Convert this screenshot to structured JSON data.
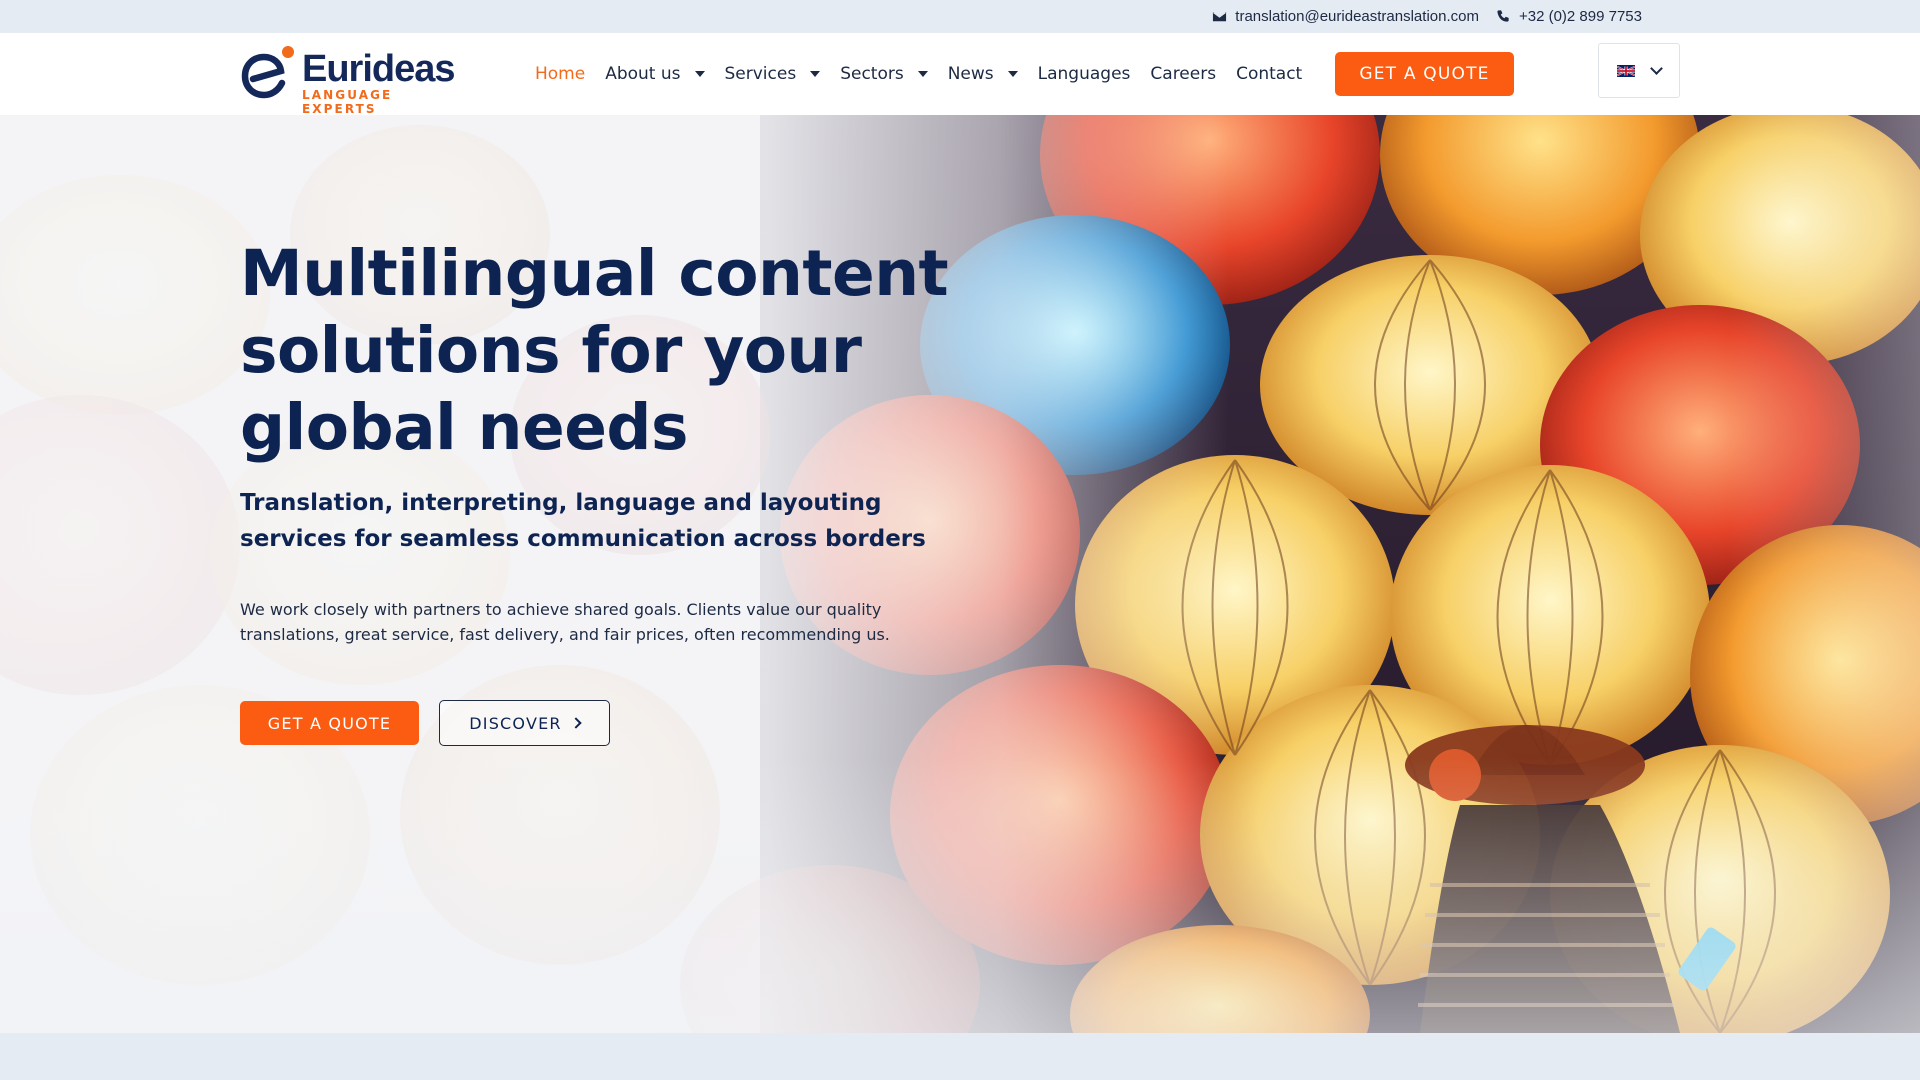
{
  "topbar": {
    "email": "translation@eurideastranslation.com",
    "phone": "+32 (0)2 899 7753",
    "email_icon": "envelope-icon",
    "phone_icon": "phone-icon"
  },
  "logo": {
    "name": "Eurideas",
    "tagline": "LANGUAGE EXPERTS"
  },
  "nav": {
    "items": [
      {
        "label": "Home",
        "active": true,
        "dropdown": false
      },
      {
        "label": "About us",
        "dropdown": true
      },
      {
        "label": "Services",
        "dropdown": true
      },
      {
        "label": "Sectors",
        "dropdown": true
      },
      {
        "label": "News",
        "dropdown": true
      },
      {
        "label": "Languages",
        "dropdown": false
      },
      {
        "label": "Careers",
        "dropdown": false
      },
      {
        "label": "Contact",
        "dropdown": false
      }
    ],
    "quote_label": "GET A QUOTE",
    "language_flag": "uk-flag-icon"
  },
  "hero": {
    "title": "Multilingual content solutions for your global needs",
    "subtitle": "Translation, interpreting, language and layouting services for seamless communication across borders",
    "description": "We work closely with partners to achieve shared goals. Clients value our quality translations, great service, fast delivery, and fair prices, often recommending us.",
    "quote_label": "GET A QUOTE",
    "discover_label": "DISCOVER"
  },
  "colors": {
    "accent": "#fb5c12",
    "navy": "#0d2453",
    "topbar_bg": "#e5ebf3"
  }
}
